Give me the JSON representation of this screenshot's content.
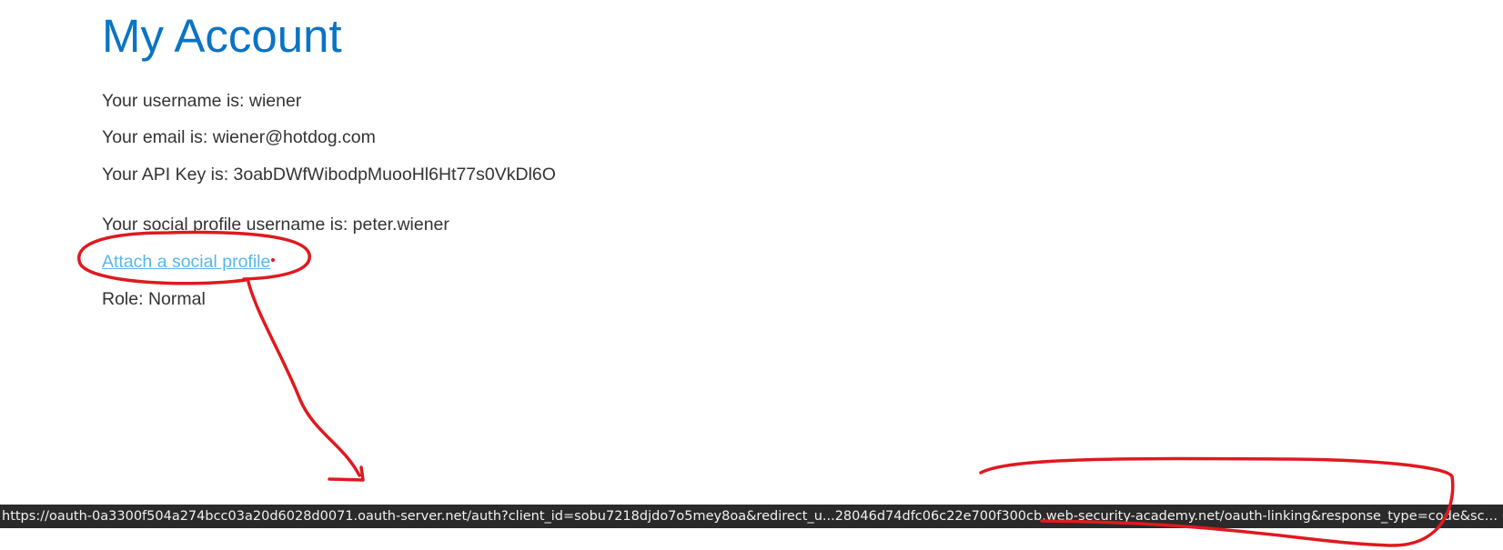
{
  "page": {
    "title": "My Account"
  },
  "account": {
    "username_line": "Your username is: wiener",
    "email_line": "Your email is: wiener@hotdog.com",
    "api_key_line": "Your API Key is: 3oabDWfWibodpMuooHl6Ht77s0VkDl6O",
    "social_line": "Your social profile username is: peter.wiener",
    "attach_link": "Attach a social profile",
    "role_line": "Role: Normal"
  },
  "status_bar": {
    "url": "https://oauth-0a3300f504a274bcc03a20d6028d0071.oauth-server.net/auth?client_id=sobu7218djdo7o5mey8oa&redirect_u...28046d74dfc06c22e700f300cb.web-security-academy.net/oauth-linking&response_type=code&scope=openid profile email"
  },
  "colors": {
    "title": "#0a74c4",
    "text": "#333333",
    "link": "#55b8e8",
    "status_bar_bg": "#2a2a2a",
    "annotation": "#e0191f"
  }
}
